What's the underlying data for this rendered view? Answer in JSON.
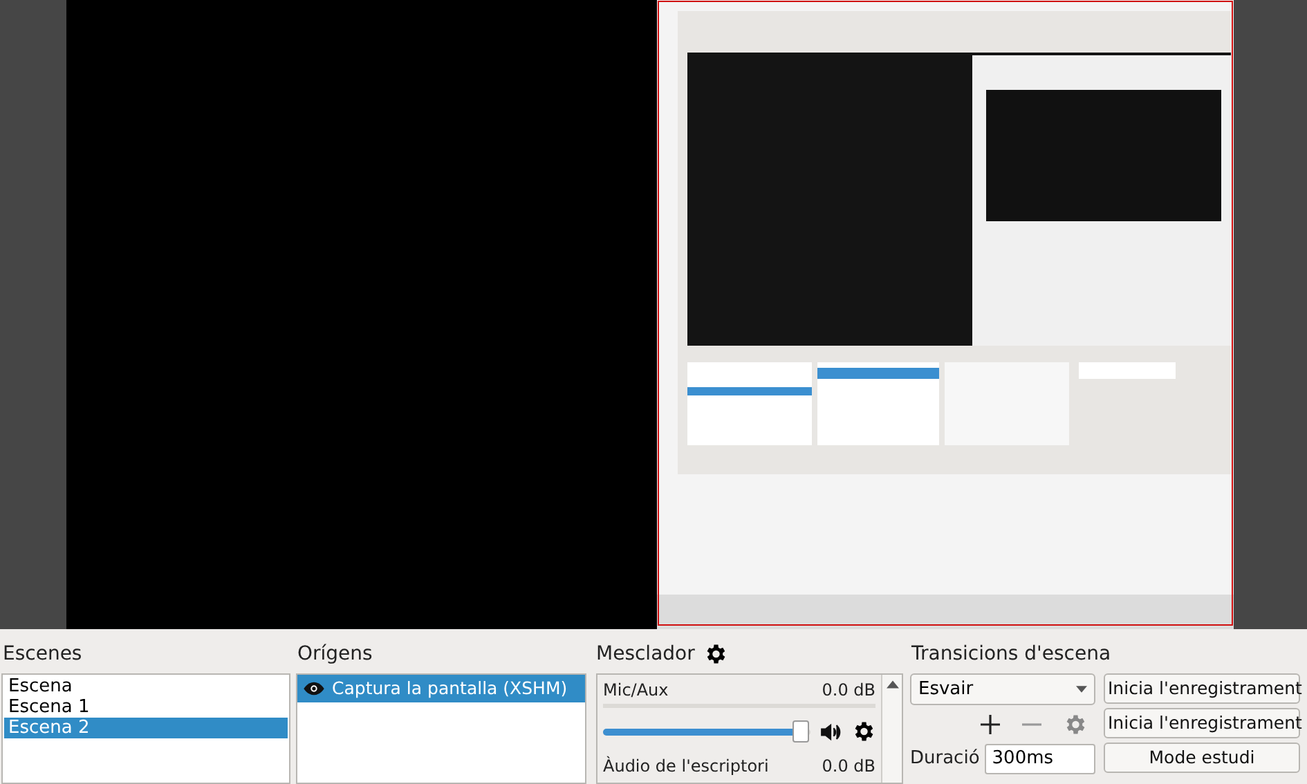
{
  "scenes": {
    "title": "Escenes",
    "items": [
      {
        "label": "Escena",
        "selected": false
      },
      {
        "label": "Escena 1",
        "selected": false
      },
      {
        "label": "Escena 2",
        "selected": true
      }
    ]
  },
  "sources": {
    "title": "Orígens",
    "items": [
      {
        "label": "Captura la pantalla (XSHM)",
        "visible": true,
        "selected": true
      }
    ]
  },
  "mixer": {
    "title": "Mesclador",
    "channels": [
      {
        "name": "Mic/Aux",
        "reading": "0.0 dB",
        "level": 0.95
      },
      {
        "name": "Àudio de l'escriptori",
        "reading": "0.0 dB"
      }
    ]
  },
  "transitions": {
    "title": "Transicions d'escena",
    "selected": "Esvair",
    "duration_label": "Duració",
    "duration": "300ms"
  },
  "controls": [
    "Inicia l'enregistrament",
    "Inicia l'enregistrament",
    "Mode estudi"
  ]
}
